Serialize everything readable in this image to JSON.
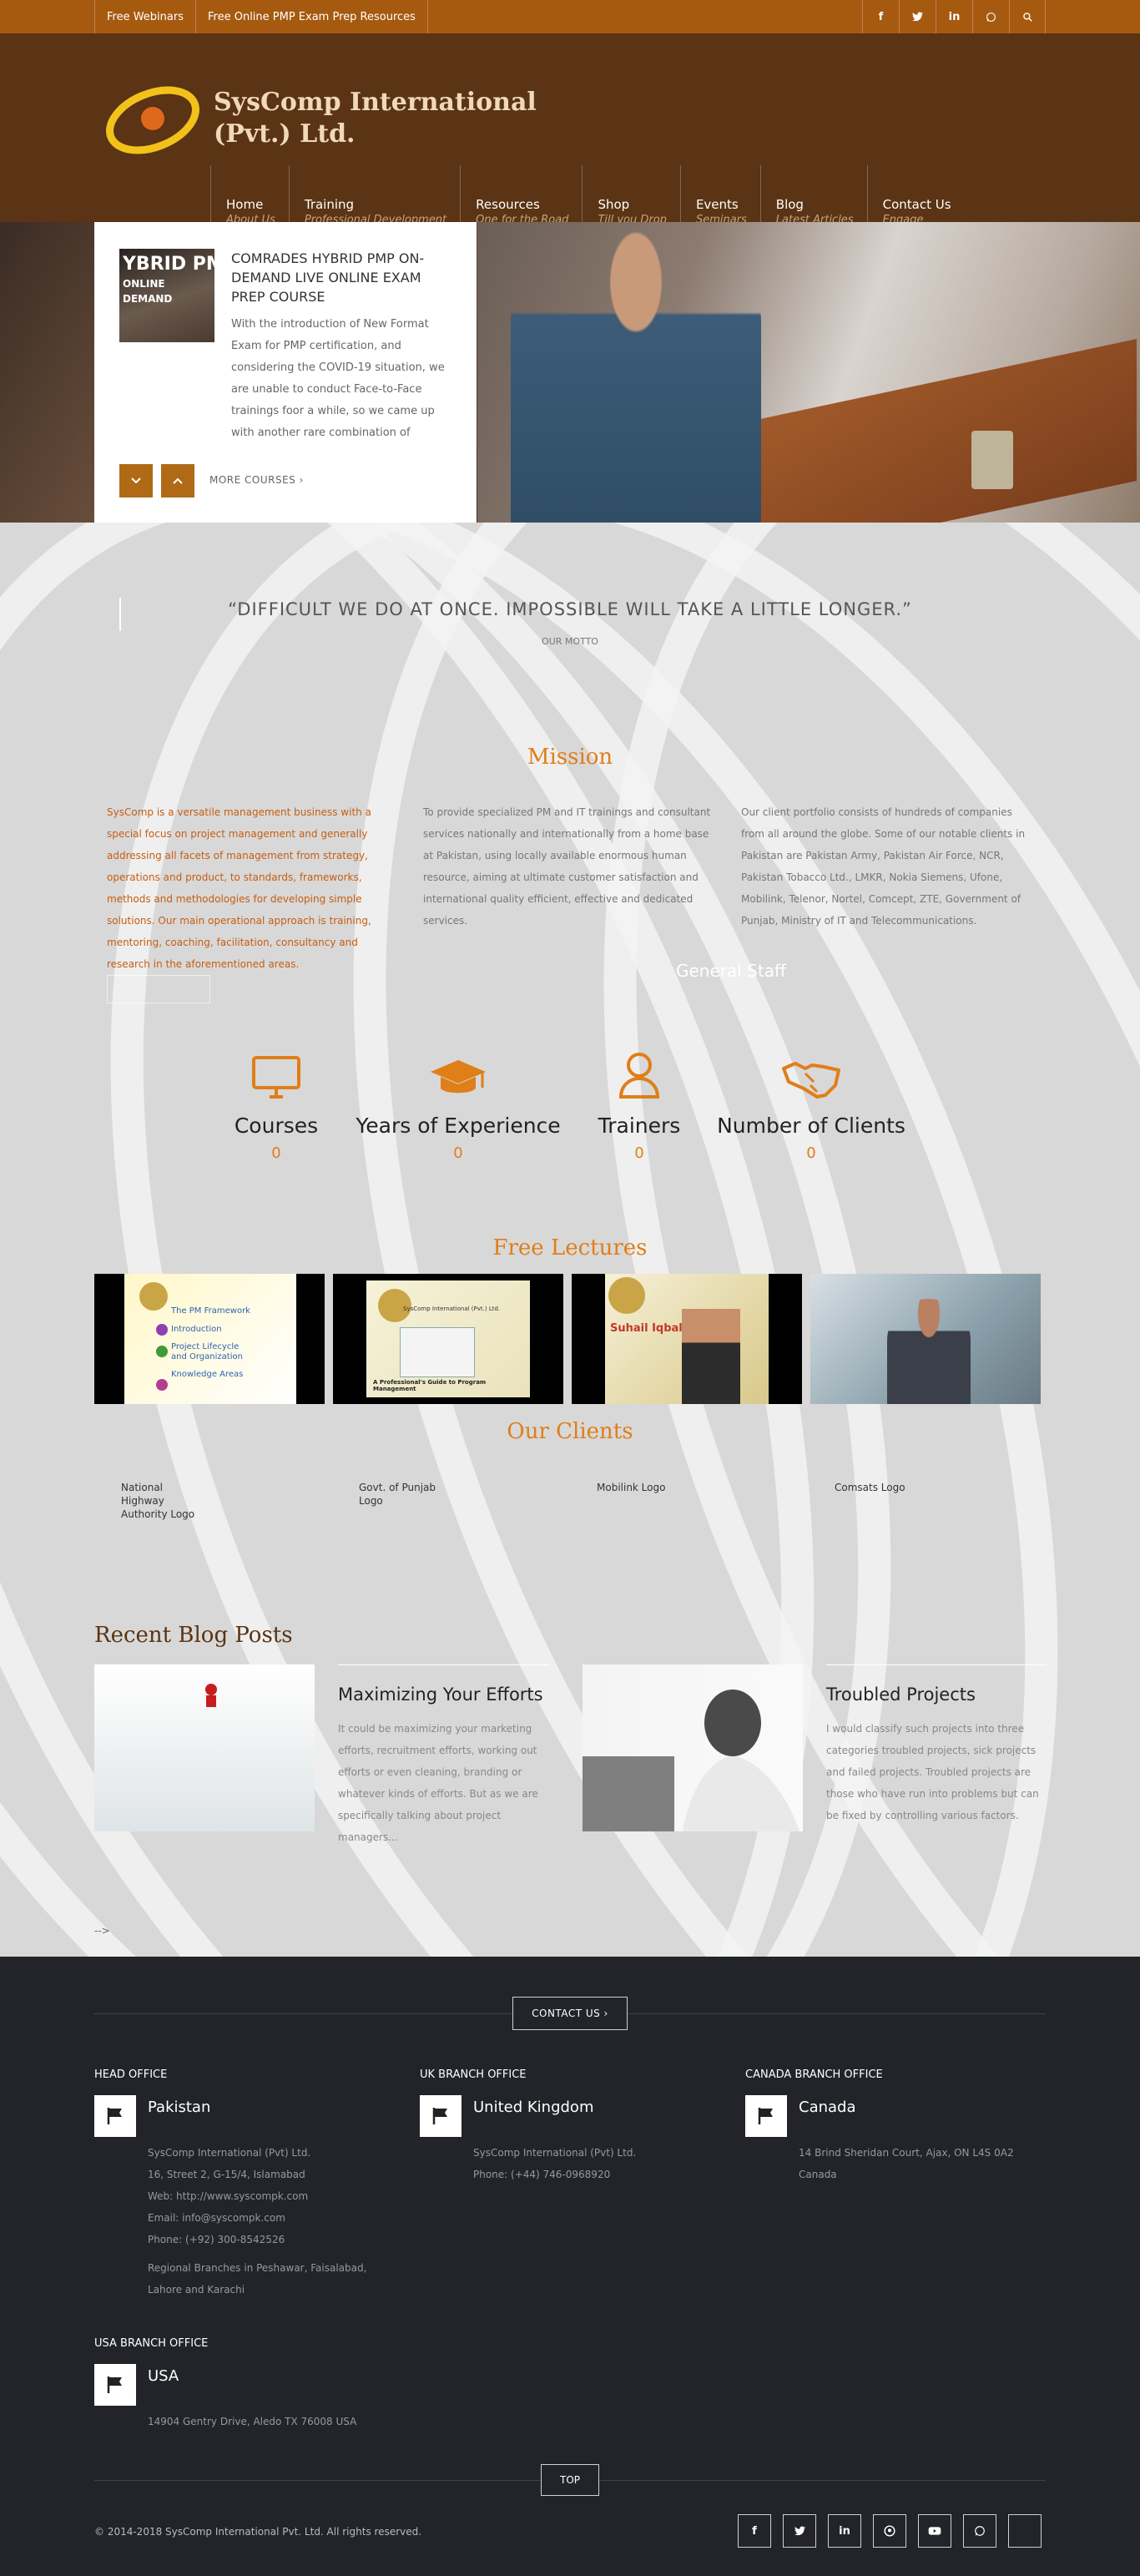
{
  "topbar": {
    "links": [
      "Free Webinars",
      "Free Online PMP Exam Prep Resources"
    ],
    "socials": [
      {
        "icon": "facebook-icon",
        "glyph": "f"
      },
      {
        "icon": "twitter-icon",
        "glyph": "🐦"
      },
      {
        "icon": "linkedin-icon",
        "glyph": "in"
      },
      {
        "icon": "whatsapp-icon",
        "glyph": "✆"
      },
      {
        "icon": "search-icon",
        "glyph": "⌕"
      }
    ]
  },
  "header": {
    "brand_line1": "SysComp International",
    "brand_line2": "(Pvt.) Ltd.",
    "nav": [
      {
        "title": "Home",
        "sub": "About Us",
        "active": true
      },
      {
        "title": "Training",
        "sub": "Professional Development"
      },
      {
        "title": "Resources",
        "sub": "One for the Road"
      },
      {
        "title": "Shop",
        "sub": "Till you Drop"
      },
      {
        "title": "Events",
        "sub": "Seminars"
      },
      {
        "title": "Blog",
        "sub": "Latest Articles"
      },
      {
        "title": "Contact Us",
        "sub": "Engage"
      }
    ]
  },
  "slider": {
    "thumb_l1": "YBRID PM",
    "thumb_l2": "ONLINE",
    "thumb_l3": "DEMAND",
    "title": "COMRADES HYBRID PMP ON-DEMAND LIVE ONLINE EXAM PREP COURSE",
    "body": "With the introduction of New Format Exam for PMP certification, and considering the COVID-19 situation, we are unable to conduct Face-to-Face trainings foor a while, so we came up with another rare combination of options. We want our clients",
    "prev_glyph": "⌄",
    "next_glyph": "⌃",
    "more_label": "MORE COURSES ›"
  },
  "main": {
    "motto": "“DIFFICULT WE DO AT ONCE. IMPOSSIBLE WILL TAKE A LITTLE LONGER.”",
    "motto_sub": "OUR MOTTO",
    "mission_title": "Mission",
    "col1": "SysComp is a versatile management business with a special focus on project management and generally addressing all facets of management from strategy, operations and product, to standards, frameworks, methods and methodologies for developing simple solutions. Our main operational approach is training, mentoring, coaching, facilitation, consultancy and research in the aforementioned areas.",
    "col2": "To provide specialized PM and IT trainings and consultant services nationally and internationally from a home base at Pakistan, using locally available enormous human resource, aiming at ultimate customer satisfaction and international quality efficient, effective and dedicated services.",
    "col3": "Our client portfolio consists of hundreds of companies from all around the globe. Some of our notable clients in Pakistan are Pakistan Army, Pakistan Air Force, NCR, Pakistan Tobacco Ltd., LMKR, Nokia Siemens, Ufone, Mobilink, Telenor, Nortel, Comcept, ZTE, Government of Punjab, Ministry of IT and Telecommunications.",
    "general_staff": "General Staff",
    "stats": [
      {
        "label": "Courses",
        "value": "0",
        "icon": "monitor-icon"
      },
      {
        "label": "Years of Experience",
        "value": "0",
        "icon": "graduation-cap-icon"
      },
      {
        "label": "Trainers",
        "value": "0",
        "icon": "user-icon"
      },
      {
        "label": "Number of Clients",
        "value": "0",
        "icon": "handshake-icon"
      }
    ],
    "lectures_title": "Free Lectures",
    "lectures": [
      {
        "lines": [
          "The PM Framework",
          "Introduction",
          "Project Lifecycle and Organization",
          "Knowledge Areas"
        ]
      },
      {
        "lines": [
          "SysComp International (Pvt.) Ltd.",
          "A Professional's Guide to Program Management"
        ]
      },
      {
        "lines": [
          "Suhail Iqbal"
        ]
      },
      {
        "lines": []
      }
    ],
    "clients_title": "Our Clients",
    "clients": [
      "National Highway Authority Logo",
      "Govt. of Punjab Logo",
      "Mobilink Logo",
      "Comsats Logo"
    ],
    "blog_title": "Recent Blog Posts",
    "posts": [
      {
        "title": "Maximizing Your Efforts",
        "body": "It could be maximizing your marketing efforts, recruitment efforts, working out efforts or even cleaning, branding or whatever kinds of efforts. But as we are specifically talking about project managers..."
      },
      {
        "title": "Troubled Projects",
        "body": "I would classify such projects into three categories troubled projects, sick projects and failed projects. Troubled projects are those who have run into problems but can be fixed by controlling various factors."
      }
    ],
    "arrow_text": "-->"
  },
  "footer": {
    "contact_label": "CONTACT US ›",
    "offices": [
      {
        "heading": "HEAD OFFICE",
        "country": "Pakistan",
        "lines": [
          "SysComp International (Pvt) Ltd.",
          "16, Street 2, G-15/4, Islamabad",
          "Web: http://www.syscompk.com",
          "Email: info@syscompk.com",
          "Phone: (+92) 300-8542526"
        ],
        "extra": "Regional Branches in Peshawar, Faisalabad, Lahore and Karachi"
      },
      {
        "heading": "UK BRANCH OFFICE",
        "country": "United Kingdom",
        "lines": [
          "SysComp International (Pvt) Ltd.",
          "Phone: (+44) 746-0968920"
        ],
        "extra": ""
      },
      {
        "heading": "CANADA BRANCH OFFICE",
        "country": "Canada",
        "lines": [
          "14 Brind Sheridan Court, Ajax, ON L4S 0A2",
          "Canada"
        ],
        "extra": ""
      },
      {
        "heading": "USA BRANCH OFFICE",
        "country": "USA",
        "lines": [
          "14904 Gentry Drive, Aledo TX 76008 USA"
        ],
        "extra": ""
      }
    ],
    "top_label": "TOP",
    "copyright": "© 2014-2018 SysComp International Pvt. Ltd. All rights reserved.",
    "socials": [
      {
        "icon": "facebook-icon",
        "glyph": "f"
      },
      {
        "icon": "twitter-icon",
        "glyph": "🐦"
      },
      {
        "icon": "linkedin-icon",
        "glyph": "in"
      },
      {
        "icon": "pinterest-icon",
        "glyph": "℗"
      },
      {
        "icon": "youtube-icon",
        "glyph": "▶"
      },
      {
        "icon": "whatsapp-icon",
        "glyph": "✆"
      },
      {
        "icon": "blank-icon",
        "glyph": ""
      }
    ]
  },
  "colors": {
    "accent": "#e07e18",
    "topbar": "#a65a10",
    "header": "#5a3414",
    "footer": "#22242a"
  }
}
